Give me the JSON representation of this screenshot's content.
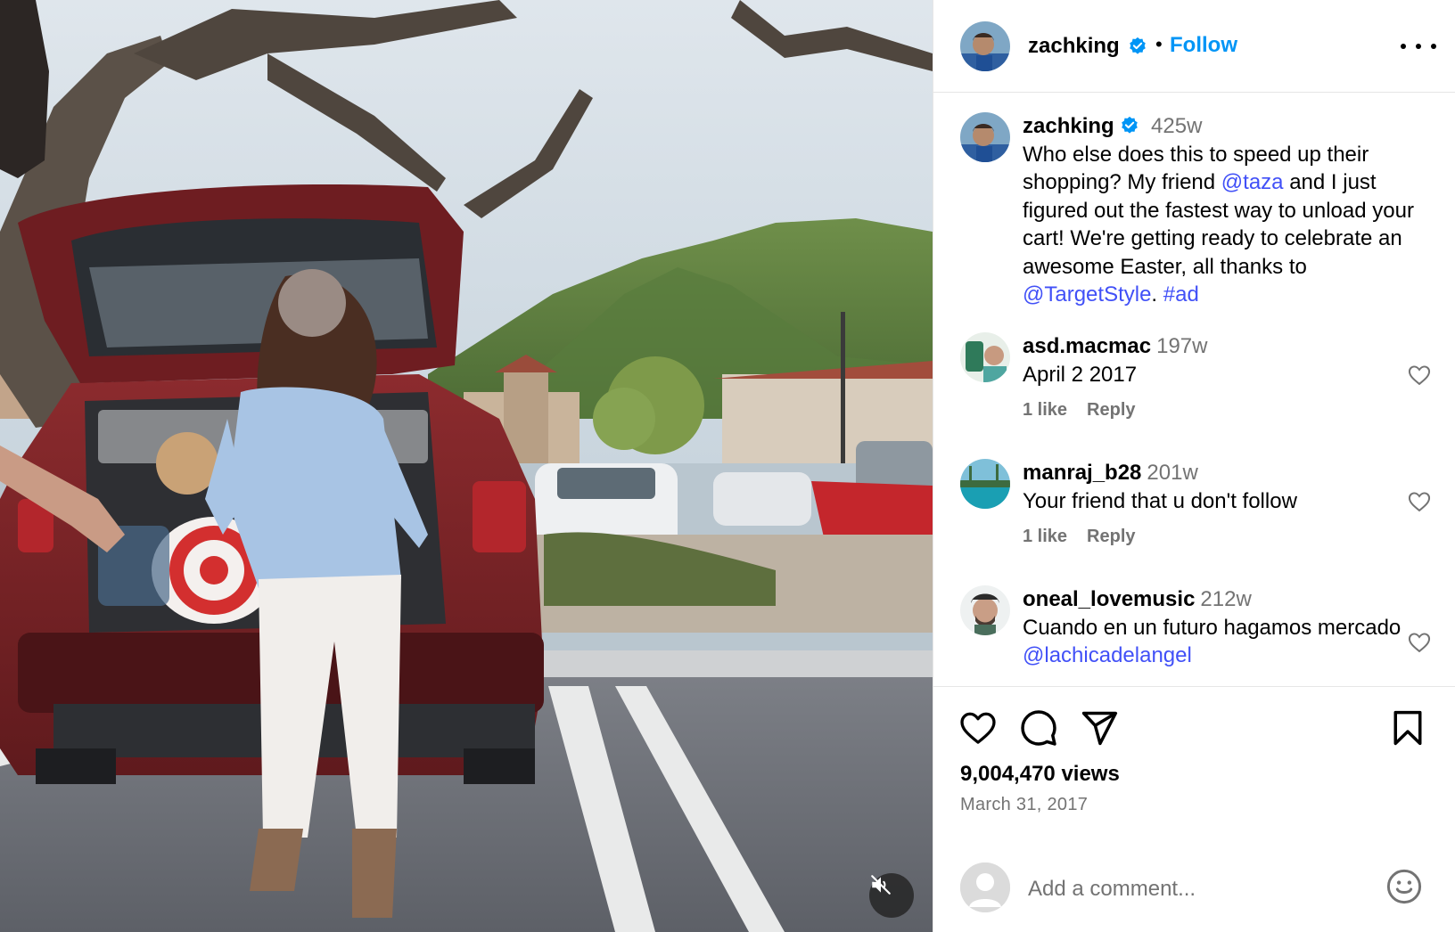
{
  "post": {
    "username": "zachking",
    "separator": "•",
    "follow_label": "Follow",
    "more_icon": "more-options-icon"
  },
  "caption": {
    "username": "zachking",
    "time": "425w",
    "text_1": "Who else does this to speed up their shopping? My friend ",
    "mention_1": "@taza",
    "text_2": " and I just figured out the fastest way to unload your cart! We're getting ready to celebrate an awesome Easter, all thanks to ",
    "mention_2": "@TargetStyle",
    "text_3": ". ",
    "hashtag": "#ad"
  },
  "comments": [
    {
      "username": "asd.macmac",
      "time": "197w",
      "text": "April 2 2017",
      "likes": "1 like",
      "reply": "Reply"
    },
    {
      "username": "manraj_b28",
      "time": "201w",
      "text": "Your friend that u don't follow",
      "likes": "1 like",
      "reply": "Reply"
    },
    {
      "username": "oneal_lovemusic",
      "time": "212w",
      "text": "Cuando en un futuro hagamos mercado ",
      "mention": "@lachicadelangel"
    }
  ],
  "stats": {
    "views": "9,004,470 views",
    "date": "March 31, 2017"
  },
  "composer": {
    "placeholder": "Add a comment..."
  },
  "colors": {
    "link": "#4150f7",
    "follow": "#0095f6",
    "secondary_text": "#737373",
    "divider": "#e6e6e6"
  }
}
